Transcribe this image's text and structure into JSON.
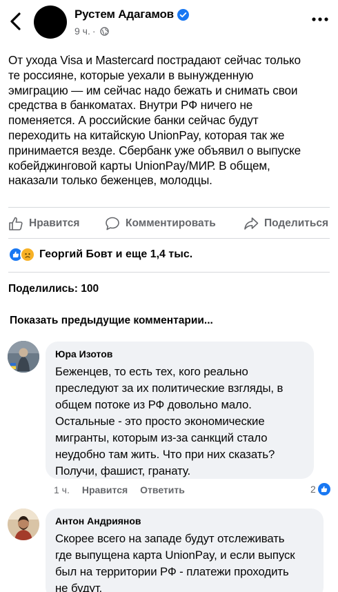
{
  "post": {
    "author": "Рустем Адагамов",
    "time": "9 ч.",
    "meta_separator": "·",
    "lines": [
      "От ухода Visa и Mastercard пострадают сейчас только",
      "те россияне, которые уехали в вынужденную",
      "эмиграцию — им сейчас надо бежать и снимать свои",
      "средства в банкоматах. Внутри РФ ничего не",
      "поменяется. А российские банки сейчас будут",
      "переходить на китайскую UnionPay, которая так же",
      "принимается везде. Сбербанк уже объявил о выпуске",
      "кобейджинговой карты UnionPay/МИР. В общем,",
      "наказали только беженцев, молодцы."
    ]
  },
  "actions": {
    "like": "Нравится",
    "comment": "Комментировать",
    "share": "Поделиться"
  },
  "reactions": {
    "summary": "Георгий Бовт и еще 1,4 тыс."
  },
  "shares": {
    "text": "Поделились: 100"
  },
  "comments_nav": {
    "previous": "Показать предыдущие комментарии..."
  },
  "comments": [
    {
      "author": "Юра Изотов",
      "lines": [
        "Беженцев, то есть тех, кого реально",
        "преследуют за их политические взгляды, в",
        "общем потоке из РФ довольно мало.",
        "Остальные - это просто экономические",
        "мигранты, которым из-за санкций стало",
        "неудобно там жить. Что при них сказать?",
        "Получи, фашист, гранату."
      ],
      "time": "1 ч.",
      "like_label": "Нравится",
      "reply_label": "Ответить",
      "likes": "2"
    },
    {
      "author": "Антон Андриянов",
      "lines": [
        "Скорее всего на западе будут отслеживать",
        "где выпущена карта UnionPay, и если выпуск",
        "был на территории РФ - платежи проходить",
        "не будут."
      ]
    }
  ],
  "colors": {
    "brand_blue": "#1877f2",
    "secondary_text": "#65676b",
    "bubble_bg": "#f0f2f5",
    "haha_yellow": "#f7b125"
  },
  "icons": {
    "back": "chevron-left-icon",
    "verified": "verified-badge-icon",
    "audience": "globe-icon",
    "more": "more-dots-icon",
    "like": "thumbs-up-icon",
    "comment": "comment-bubble-icon",
    "share": "share-arrow-icon",
    "reaction_like": "like-reaction-icon",
    "reaction_sad": "sad-reaction-icon"
  }
}
